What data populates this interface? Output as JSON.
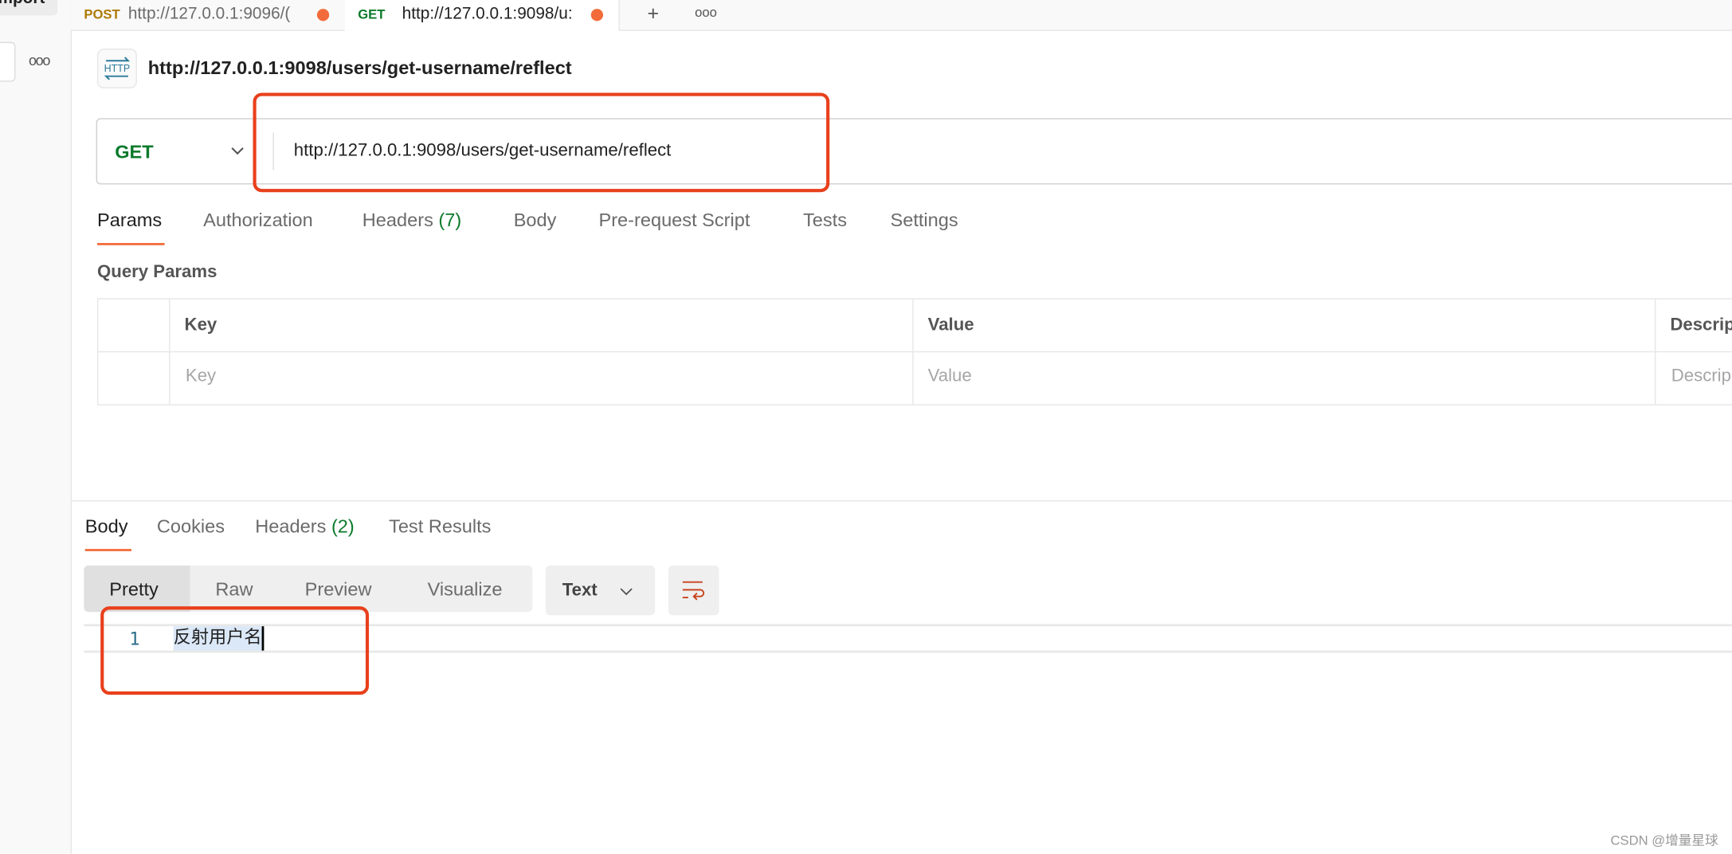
{
  "sidebar": {
    "import_label": "Import",
    "more_icon": "ellipsis-icon"
  },
  "tabs": [
    {
      "method": "POST",
      "url": "http://127.0.0.1:9096/(",
      "unsaved": true
    },
    {
      "method": "GET",
      "url": "http://127.0.0.1:9098/u:",
      "unsaved": true
    }
  ],
  "tabbar": {
    "new_tab": "+",
    "more": "ooo"
  },
  "request": {
    "title": "http://127.0.0.1:9098/users/get-username/reflect",
    "icon_label": "HTTP",
    "method": "GET",
    "url": "http://127.0.0.1:9098/users/get-username/reflect",
    "tabs": [
      {
        "label": "Params",
        "count": ""
      },
      {
        "label": "Authorization",
        "count": ""
      },
      {
        "label": "Headers",
        "count": "(7)"
      },
      {
        "label": "Body",
        "count": ""
      },
      {
        "label": "Pre-request Script",
        "count": ""
      },
      {
        "label": "Tests",
        "count": ""
      },
      {
        "label": "Settings",
        "count": ""
      }
    ],
    "active_tab": "Params",
    "query_params_label": "Query Params",
    "table": {
      "headers": [
        "Key",
        "Value",
        "Descrip"
      ],
      "placeholders": [
        "Key",
        "Value",
        "Descrip"
      ]
    }
  },
  "response": {
    "tabs": [
      {
        "label": "Body",
        "count": ""
      },
      {
        "label": "Cookies",
        "count": ""
      },
      {
        "label": "Headers",
        "count": "(2)"
      },
      {
        "label": "Test Results",
        "count": ""
      }
    ],
    "active_tab": "Body",
    "views": [
      "Pretty",
      "Raw",
      "Preview",
      "Visualize"
    ],
    "active_view": "Pretty",
    "format": "Text",
    "lines": [
      {
        "number": "1",
        "text": "反射用户名"
      }
    ]
  },
  "colors": {
    "accent": "#f26b3a",
    "get": "#0b7a2b",
    "post": "#ad7a03",
    "annotation": "#e8401c"
  },
  "watermark": "CSDN @增量星球"
}
